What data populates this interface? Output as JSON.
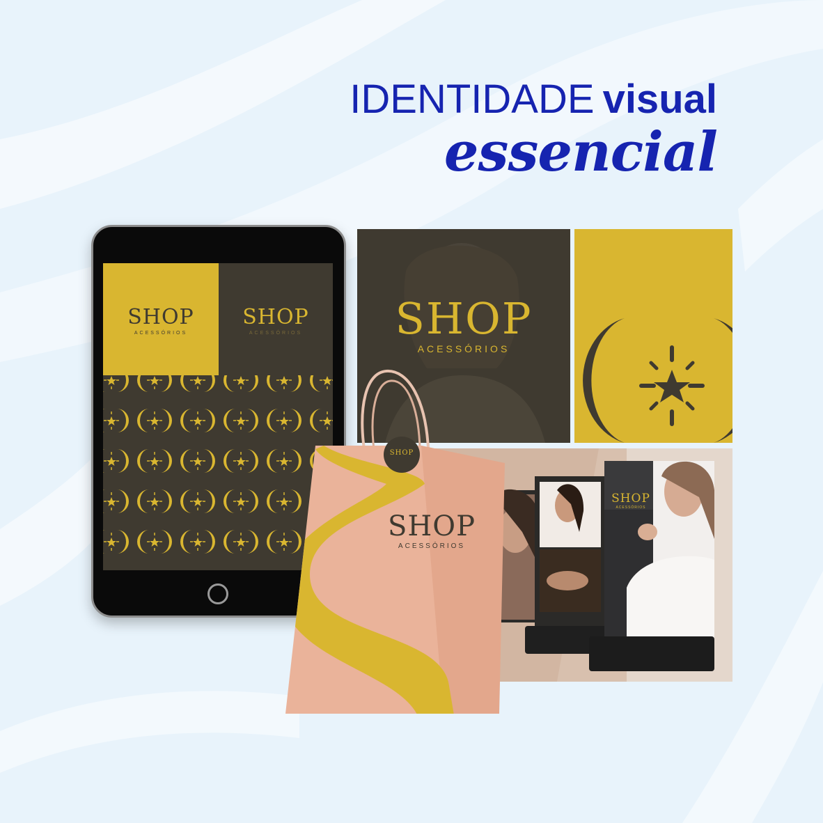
{
  "headline": {
    "line1_light": "IDENTIDADE",
    "line1_bold": "visual",
    "line2": "essencial"
  },
  "brand": {
    "name": "SHOP",
    "tagline": "ACESSÓRIOS"
  },
  "colors": {
    "title_blue": "#1624b0",
    "brand_gold": "#d9b630",
    "brand_dark": "#3f3a30",
    "bag_kraft": "#e8ad92",
    "background": "#e8f3fb"
  },
  "icons": [
    "moon-star-emblem-icon",
    "star-icon"
  ]
}
